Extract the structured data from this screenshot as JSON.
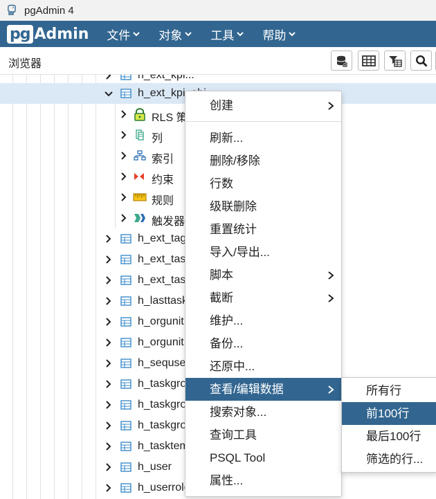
{
  "window": {
    "title": "pgAdmin 4"
  },
  "navbar": {
    "logo_pg": "pg",
    "logo_admin": "Admin",
    "menus": [
      "文件",
      "对象",
      "工具",
      "帮助"
    ]
  },
  "toolbar": {
    "label": "浏览器",
    "buttons": [
      "database-icon",
      "grid-icon",
      "filter-table-icon",
      "search-icon"
    ]
  },
  "tree": {
    "rows": [
      {
        "label": "h_ext_kpi...",
        "icon": "table-icon",
        "expanded": false
      },
      {
        "label": "h_ext_kpi_obj",
        "icon": "table-icon",
        "expanded": true,
        "selected": true
      },
      {
        "label": "RLS 策略",
        "icon": "lock-icon"
      },
      {
        "label": "列",
        "icon": "columns-icon"
      },
      {
        "label": "索引",
        "icon": "index-icon"
      },
      {
        "label": "约束",
        "icon": "constraint-icon"
      },
      {
        "label": "规则",
        "icon": "rule-icon"
      },
      {
        "label": "触发器",
        "icon": "trigger-icon"
      },
      {
        "label": "h_ext_tag",
        "icon": "table-icon"
      },
      {
        "label": "h_ext_task",
        "icon": "table-icon"
      },
      {
        "label": "h_ext_task",
        "icon": "table-icon"
      },
      {
        "label": "h_lasttask",
        "icon": "table-icon"
      },
      {
        "label": "h_orgunit",
        "icon": "table-icon"
      },
      {
        "label": "h_orgunit",
        "icon": "table-icon"
      },
      {
        "label": "h_sequse",
        "icon": "table-icon"
      },
      {
        "label": "h_taskgro",
        "icon": "table-icon"
      },
      {
        "label": "h_taskgro",
        "icon": "table-icon"
      },
      {
        "label": "h_taskgro",
        "icon": "table-icon"
      },
      {
        "label": "h_tasktem",
        "icon": "table-icon"
      },
      {
        "label": "h_user",
        "icon": "table-icon"
      },
      {
        "label": "h_userrole",
        "icon": "table-icon"
      }
    ]
  },
  "context_menu": {
    "items": [
      {
        "label": "创建",
        "submenu": true
      },
      {
        "label": "刷新..."
      },
      {
        "label": "删除/移除"
      },
      {
        "label": "行数"
      },
      {
        "label": "级联删除"
      },
      {
        "label": "重置统计"
      },
      {
        "label": "导入/导出..."
      },
      {
        "label": "脚本",
        "submenu": true
      },
      {
        "label": "截断",
        "submenu": true
      },
      {
        "label": "维护..."
      },
      {
        "label": "备份..."
      },
      {
        "label": "还原中..."
      },
      {
        "label": "查看/编辑数据",
        "submenu": true,
        "active": true
      },
      {
        "label": "搜索对象..."
      },
      {
        "label": "查询工具"
      },
      {
        "label": "PSQL Tool"
      },
      {
        "label": "属性..."
      }
    ]
  },
  "submenu": {
    "items": [
      {
        "label": "所有行"
      },
      {
        "label": "前100行",
        "active": true
      },
      {
        "label": "最后100行"
      },
      {
        "label": "筛选的行..."
      }
    ]
  },
  "colors": {
    "navbar": "#326690",
    "selection": "#dbe8f5",
    "menu_active": "#326690",
    "table_icon": "#3d8ccb"
  }
}
